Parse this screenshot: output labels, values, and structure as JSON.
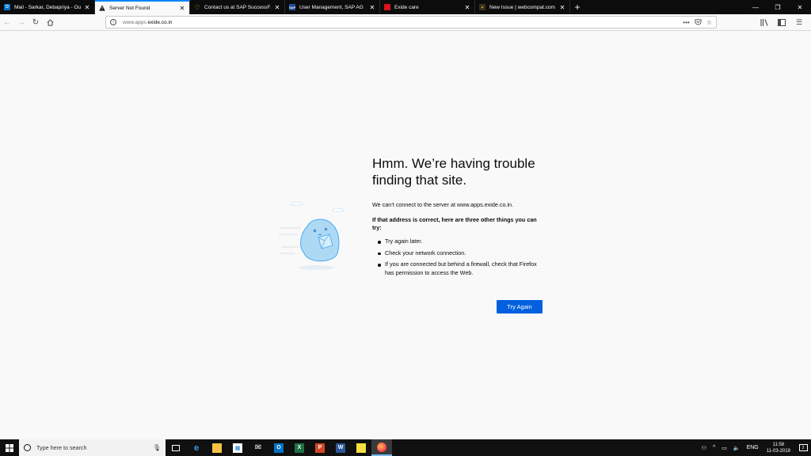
{
  "browser": {
    "tabs": [
      {
        "title": "Mail - Sarkar, Debapriya - Outlook",
        "icon": "outlook-icon",
        "active": false
      },
      {
        "title": "Server Not Found",
        "icon": "warning-icon",
        "active": true
      },
      {
        "title": "Contact us at SAP SuccessFactors",
        "icon": "sap-heart-icon",
        "active": false
      },
      {
        "title": "User Management, SAP AG",
        "icon": "sap-icon",
        "active": false
      },
      {
        "title": "Exide care",
        "icon": "exide-icon",
        "active": false
      },
      {
        "title": "New Issue | webcompat.com",
        "icon": "webcompat-icon",
        "active": false
      }
    ],
    "new_tab_label": "+",
    "url_prefix": "www.apps.",
    "url_host": "exide.co.in",
    "accent": "#0a84ff"
  },
  "error": {
    "title": "Hmm. We’re having trouble finding that site.",
    "description": "We can’t connect to the server at www.apps.exide.co.in.",
    "subtitle": "If that address is correct, here are three other things you can try:",
    "suggestions": [
      "Try again later.",
      "Check your network connection.",
      "If you are connected but behind a firewall, check that Firefox has permission to access the Web."
    ],
    "button_label": "Try Again",
    "button_color": "#0060df"
  },
  "taskbar": {
    "search_placeholder": "Type here to search",
    "apps": [
      "task-view-icon",
      "edge-icon",
      "file-explorer-icon",
      "store-icon",
      "mail-icon",
      "outlook-icon",
      "excel-icon",
      "powerpoint-icon",
      "word-icon",
      "sticky-notes-icon",
      "firefox-icon"
    ],
    "language": "ENG",
    "time": "11:58",
    "date": "11-03-2019",
    "notification_count": "2"
  }
}
